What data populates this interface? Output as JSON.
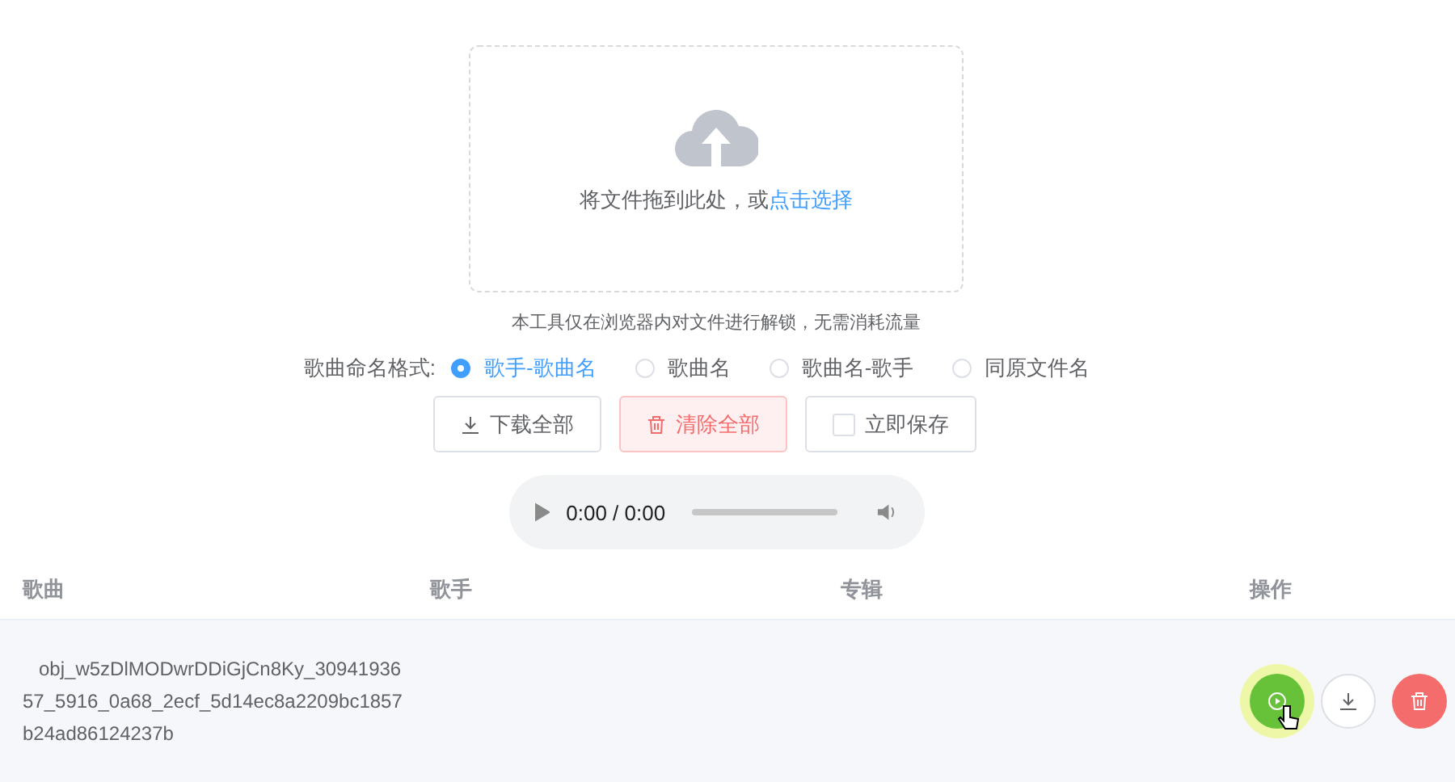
{
  "upload": {
    "text": "将文件拖到此处，或",
    "link": "点击选择",
    "note": "本工具仅在浏览器内对文件进行解锁，无需消耗流量"
  },
  "naming": {
    "label": "歌曲命名格式:",
    "options": [
      {
        "label": "歌手-歌曲名",
        "selected": true
      },
      {
        "label": "歌曲名",
        "selected": false
      },
      {
        "label": "歌曲名-歌手",
        "selected": false
      },
      {
        "label": "同原文件名",
        "selected": false
      }
    ]
  },
  "actions": [
    {
      "kind": "download",
      "label": "下载全部"
    },
    {
      "kind": "clear",
      "label": "清除全部"
    },
    {
      "kind": "checkbox",
      "label": "立即保存",
      "checked": false
    }
  ],
  "player": {
    "time": "0:00 / 0:00"
  },
  "table": {
    "columns": [
      "歌曲",
      "歌手",
      "专辑",
      "操作"
    ],
    "rows": [
      {
        "song": "obj_w5zDlMODwrDDiGjCn8Ky_3094193657_5916_0a68_2ecf_5d14ec8a2209bc1857b24ad86124237b",
        "buttons": [
          {
            "kind": "play",
            "hover": true
          },
          {
            "kind": "download",
            "hover": false
          },
          {
            "kind": "delete",
            "hover": false
          }
        ]
      }
    ]
  }
}
